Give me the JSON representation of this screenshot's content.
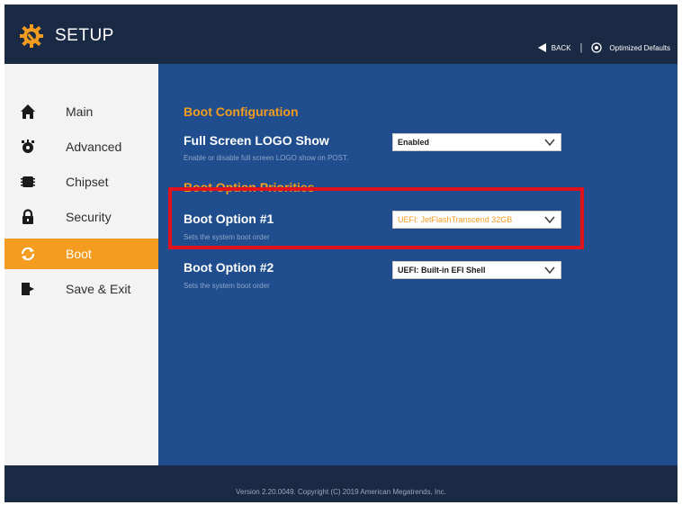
{
  "header": {
    "title": "SETUP",
    "back_label": "BACK",
    "separator": "|",
    "defaults_label": "Optimized Defaults",
    "logo_icon": "gear-wrench-icon"
  },
  "sidebar": {
    "items": [
      {
        "label": "Main",
        "icon": "home-icon",
        "active": false
      },
      {
        "label": "Advanced",
        "icon": "advanced-gear-icon",
        "active": false
      },
      {
        "label": "Chipset",
        "icon": "chip-icon",
        "active": false
      },
      {
        "label": "Security",
        "icon": "lock-icon",
        "active": false
      },
      {
        "label": "Boot",
        "icon": "refresh-icon",
        "active": true
      },
      {
        "label": "Save & Exit",
        "icon": "exit-door-icon",
        "active": false
      }
    ]
  },
  "content": {
    "boot_config_title": "Boot Configuration",
    "logo_show": {
      "label": "Full Screen LOGO Show",
      "desc": "Enable or disable full screen LOGO show on POST.",
      "value": "Enabled"
    },
    "priorities_title": "Boot Option Priorities",
    "boot_option_1": {
      "label": "Boot Option #1",
      "desc": "Sets the system boot order",
      "value": "UEFI: JetFlashTranscend 32GB"
    },
    "boot_option_2": {
      "label": "Boot Option #2",
      "desc": "Sets the system boot order",
      "value": "UEFI: Built-in EFI Shell"
    }
  },
  "footer": {
    "text": "Version 2.20.0049. Copyright (C) 2019 American Megatrends, Inc."
  },
  "colors": {
    "accent": "#f39c1f",
    "content_bg": "#1f4d8d",
    "header_bg": "#1b2a44",
    "highlight_box": "#e0121b"
  }
}
